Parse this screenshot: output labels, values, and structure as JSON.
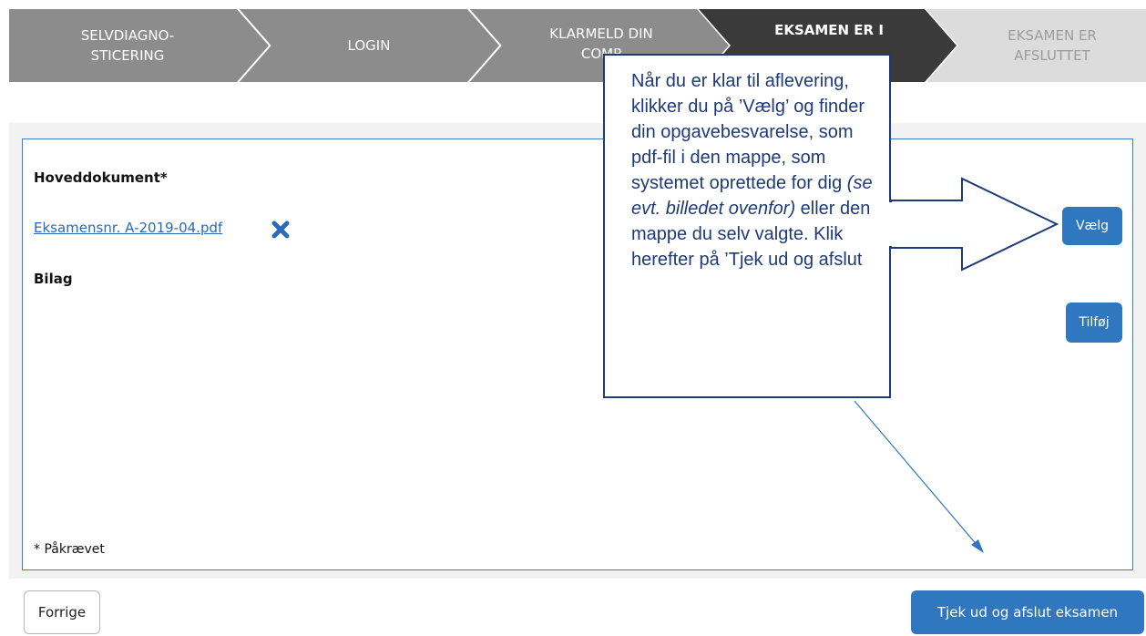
{
  "steps": [
    {
      "line1": "SELVDIAGNO-",
      "line2": "STICERING",
      "state": "done"
    },
    {
      "line1": "LOGIN",
      "line2": "",
      "state": "done"
    },
    {
      "line1": "KLARMELD DIN",
      "line2": "COMP",
      "state": "done"
    },
    {
      "line1": "EKSAMEN ER I",
      "line2": "",
      "state": "active"
    },
    {
      "line1": "EKSAMEN ER",
      "line2": "AFSLUTTET",
      "state": "todo"
    }
  ],
  "panel": {
    "main_document_label": "Hoveddokument*",
    "file_name": "Eksamensnr. A-2019-04.pdf",
    "attachments_label": "Bilag",
    "required_note": "* Påkrævet"
  },
  "buttons": {
    "choose": "Vælg",
    "add": "Tilføj",
    "previous": "Forrige",
    "checkout": "Tjek ud og afslut eksamen"
  },
  "callout": {
    "text_before": "Når du er klar til aflevering, klikker du på ’Vælg’ og finder din opgavebesvarelse, som pdf-fil i den mappe, som systemet oprettede for dig ",
    "text_italic": "(se evt. billedet ovenfor)",
    "text_after": " eller den mappe du selv valgte. Klik herefter på ’Tjek ud og afslut"
  },
  "colors": {
    "step_done": "#8c8c8c",
    "step_active": "#3a3a3a",
    "step_todo": "#dcdcdc",
    "accent": "#2f77be",
    "callout_border": "#1f3a78"
  },
  "icons": {
    "remove": "close-x-icon",
    "arrow": "arrow-right-icon"
  }
}
